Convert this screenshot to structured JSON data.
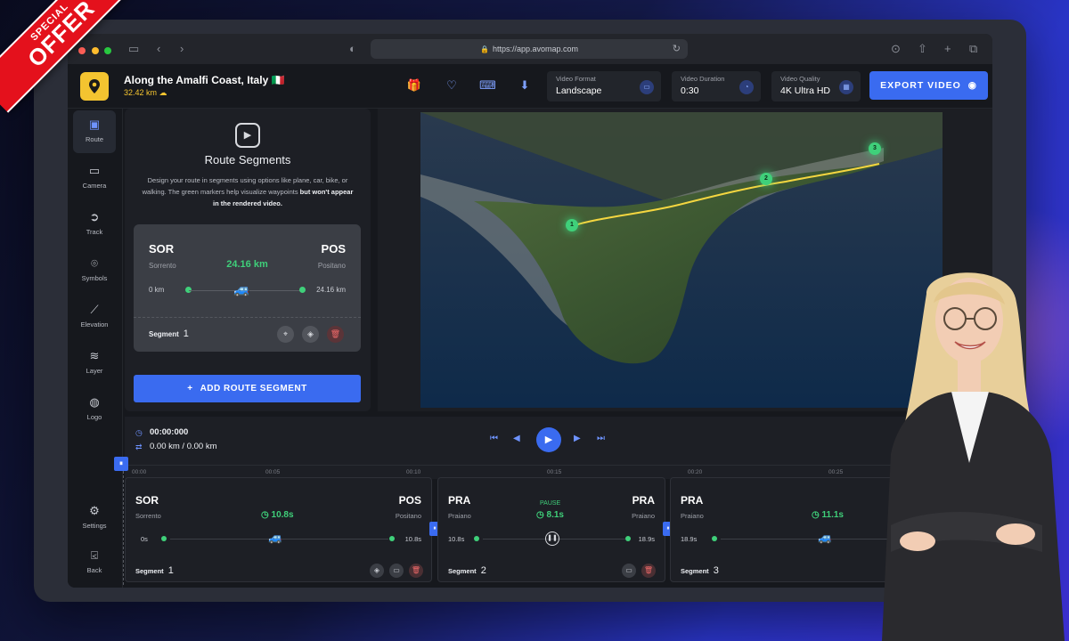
{
  "promo": {
    "line1": "SPECIAL",
    "line2": "OFFER"
  },
  "browser": {
    "url": "https://app.avomap.com"
  },
  "header": {
    "title": "Along the Amalfi Coast, Italy 🇮🇹",
    "distance": "32.42 km ☁",
    "video_format": {
      "label": "Video Format",
      "value": "Landscape"
    },
    "video_duration": {
      "label": "Video Duration",
      "value": "0:30"
    },
    "video_quality": {
      "label": "Video Quality",
      "value": "4K Ultra HD"
    },
    "export_label": "EXPORT VIDEO"
  },
  "nav": {
    "items": [
      "Route",
      "Camera",
      "Track",
      "Symbols",
      "Elevation",
      "Layer",
      "Logo"
    ],
    "settings": "Settings",
    "back": "Back"
  },
  "route_panel": {
    "title": "Route Segments",
    "desc": "Design your route in segments using options like plane, car, bike, or walking. The green markers help visualize waypoints",
    "desc_bold": "but won't appear in the rendered video.",
    "card": {
      "from_code": "SOR",
      "from_name": "Sorrento",
      "to_code": "POS",
      "to_name": "Positano",
      "distance": "24.16 km",
      "start": "0 km",
      "end": "24.16 km",
      "segment_label": "Segment",
      "segment_num": "1"
    },
    "add_label": "ADD ROUTE SEGMENT"
  },
  "map": {
    "waypoints": [
      "1",
      "2",
      "3"
    ]
  },
  "playback": {
    "time": "00:00:000",
    "distance": "0.00 km / 0.00 km"
  },
  "ruler": [
    "00:00",
    "00:05",
    "00:10",
    "00:15",
    "00:20",
    "00:25"
  ],
  "timeline": [
    {
      "from_code": "SOR",
      "from_name": "Sorrento",
      "to_code": "POS",
      "to_name": "Positano",
      "duration": "10.8s",
      "start": "0s",
      "end": "10.8s",
      "segment_label": "Segment",
      "segment_num": "1"
    },
    {
      "from_code": "PRA",
      "from_name": "Praiano",
      "to_code": "PRA",
      "to_name": "Praiano",
      "pause": "PAUSE",
      "duration": "8.1s",
      "start": "10.8s",
      "end": "18.9s",
      "segment_label": "Segment",
      "segment_num": "2"
    },
    {
      "from_code": "PRA",
      "from_name": "Praiano",
      "duration": "11.1s",
      "start": "18.9s",
      "segment_label": "Segment",
      "segment_num": "3"
    }
  ],
  "colors": {
    "accent": "#3a6bf0",
    "green": "#3fd07a",
    "logo": "#f4c430",
    "offer": "#e4111c"
  }
}
